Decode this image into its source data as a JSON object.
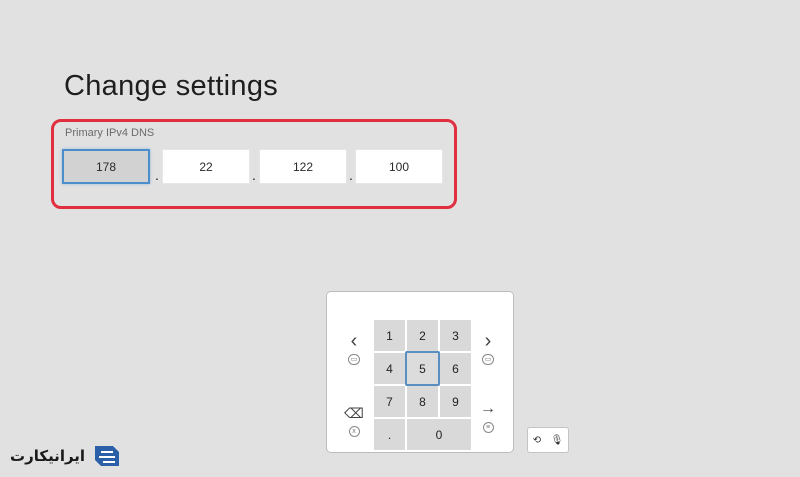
{
  "page": {
    "title": "Change settings"
  },
  "dns": {
    "label": "Primary IPv4 DNS",
    "octets": [
      "178",
      "22",
      "122",
      "100"
    ],
    "separator": "."
  },
  "keypad": {
    "rows": [
      [
        "1",
        "2",
        "3"
      ],
      [
        "4",
        "5",
        "6"
      ],
      [
        "7",
        "8",
        "9"
      ]
    ],
    "bottom": {
      "dot": ".",
      "zero": "0"
    },
    "focused_key": "5",
    "left_arrow": "‹",
    "right_arrow": "›",
    "backspace": "⌫",
    "enter": "→"
  },
  "logo": {
    "text": "ایرانیکارت"
  },
  "colors": {
    "background": "#e1e1e1",
    "highlight": "#e0303f",
    "focus": "#4c8dcc"
  }
}
